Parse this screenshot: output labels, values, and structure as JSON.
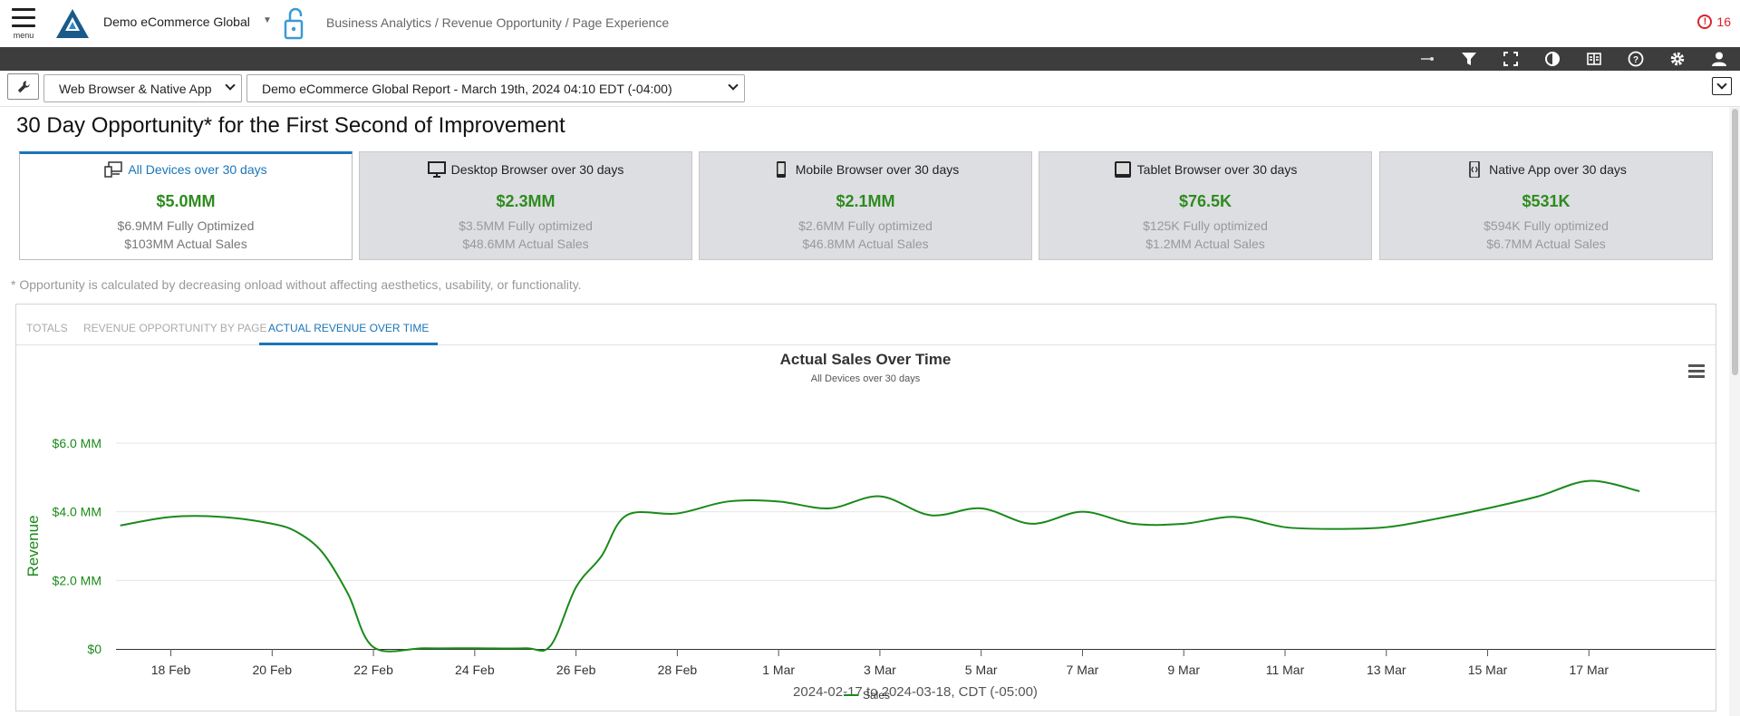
{
  "header": {
    "menu_label": "menu",
    "app_title": "Demo eCommerce Global",
    "breadcrumb": "Business Analytics / Revenue Opportunity / Page Experience",
    "alert_count": "16",
    "brand_color": "#1a75b8",
    "alert_color": "#d9232a"
  },
  "toolbar": {
    "icons": [
      "pin-icon",
      "filter-icon",
      "fullscreen-icon",
      "contrast-icon",
      "book-icon",
      "help-icon",
      "gear-icon",
      "user-icon"
    ]
  },
  "selectors": {
    "platform": "Web Browser & Native App",
    "report": "Demo eCommerce Global Report - March 19th, 2024 04:10 EDT (-04:00)"
  },
  "page": {
    "title": "30 Day Opportunity* for the First Second of Improvement",
    "footnote": "* Opportunity is calculated by decreasing onload without affecting aesthetics, usability, or functionality."
  },
  "cards": [
    {
      "icon": "devices-icon",
      "label": "All Devices over 30 days",
      "value": "$5.0MM",
      "optimized": "$6.9MM Fully Optimized",
      "actual": "$103MM Actual Sales",
      "active": true
    },
    {
      "icon": "desktop-icon",
      "label": "Desktop Browser over 30 days",
      "value": "$2.3MM",
      "optimized": "$3.5MM Fully optimized",
      "actual": "$48.6MM Actual Sales",
      "active": false
    },
    {
      "icon": "mobile-icon",
      "label": "Mobile Browser over 30 days",
      "value": "$2.1MM",
      "optimized": "$2.6MM Fully optimized",
      "actual": "$46.8MM Actual Sales",
      "active": false
    },
    {
      "icon": "tablet-icon",
      "label": "Tablet Browser over 30 days",
      "value": "$76.5K",
      "optimized": "$125K Fully optimized",
      "actual": "$1.2MM Actual Sales",
      "active": false
    },
    {
      "icon": "native-app-icon",
      "label": "Native App over 30 days",
      "value": "$531K",
      "optimized": "$594K Fully optimized",
      "actual": "$6.7MM Actual Sales",
      "active": false
    }
  ],
  "tabs": [
    {
      "label": "TOTALS",
      "active": false
    },
    {
      "label": "REVENUE OPPORTUNITY BY PAGE",
      "active": false
    },
    {
      "label": "ACTUAL REVENUE OVER TIME",
      "active": true
    }
  ],
  "chart_data": {
    "type": "line",
    "title": "Actual Sales Over Time",
    "subtitle": "All Devices over 30 days",
    "xlabel": "2024-02-17 to 2024-03-18, CDT (-05:00)",
    "ylabel": "Revenue",
    "y_ticks": [
      "$0",
      "$2.0 MM",
      "$4.0 MM",
      "$6.0 MM"
    ],
    "y_tick_values": [
      0,
      2,
      4,
      6
    ],
    "ylim": [
      0,
      6
    ],
    "y_unit": "MM USD",
    "x_tick_labels": [
      "18 Feb",
      "20 Feb",
      "22 Feb",
      "24 Feb",
      "26 Feb",
      "28 Feb",
      "1 Mar",
      "3 Mar",
      "5 Mar",
      "7 Mar",
      "9 Mar",
      "11 Mar",
      "13 Mar",
      "15 Mar",
      "17 Mar"
    ],
    "xlim": [
      "2024-02-16T22:00",
      "2024-03-19T12:00"
    ],
    "grid": true,
    "legend_position": "bottom-center",
    "series": [
      {
        "name": "Sales",
        "color": "#1a8a1a",
        "points": [
          [
            "2024-02-17T00:00",
            3.6
          ],
          [
            "2024-02-18T00:00",
            3.85
          ],
          [
            "2024-02-19T00:00",
            3.85
          ],
          [
            "2024-02-20T00:00",
            3.65
          ],
          [
            "2024-02-20T12:00",
            3.4
          ],
          [
            "2024-02-21T00:00",
            2.8
          ],
          [
            "2024-02-21T12:00",
            1.6
          ],
          [
            "2024-02-22T00:00",
            0.05
          ],
          [
            "2024-02-23T00:00",
            0.02
          ],
          [
            "2024-02-24T00:00",
            0.02
          ],
          [
            "2024-02-25T00:00",
            0.02
          ],
          [
            "2024-02-25T12:00",
            0.1
          ],
          [
            "2024-02-26T00:00",
            1.8
          ],
          [
            "2024-02-26T12:00",
            2.7
          ],
          [
            "2024-02-27T00:00",
            3.9
          ],
          [
            "2024-02-28T00:00",
            3.95
          ],
          [
            "2024-02-29T00:00",
            4.3
          ],
          [
            "2024-03-01T00:00",
            4.3
          ],
          [
            "2024-03-02T00:00",
            4.1
          ],
          [
            "2024-03-03T00:00",
            4.45
          ],
          [
            "2024-03-04T00:00",
            3.9
          ],
          [
            "2024-03-05T00:00",
            4.1
          ],
          [
            "2024-03-06T00:00",
            3.65
          ],
          [
            "2024-03-07T00:00",
            4.0
          ],
          [
            "2024-03-08T00:00",
            3.65
          ],
          [
            "2024-03-09T00:00",
            3.65
          ],
          [
            "2024-03-10T00:00",
            3.85
          ],
          [
            "2024-03-11T00:00",
            3.55
          ],
          [
            "2024-03-12T00:00",
            3.5
          ],
          [
            "2024-03-13T00:00",
            3.55
          ],
          [
            "2024-03-14T00:00",
            3.8
          ],
          [
            "2024-03-15T00:00",
            4.1
          ],
          [
            "2024-03-16T00:00",
            4.45
          ],
          [
            "2024-03-17T00:00",
            4.9
          ],
          [
            "2024-03-18T00:00",
            4.6
          ]
        ]
      }
    ]
  }
}
